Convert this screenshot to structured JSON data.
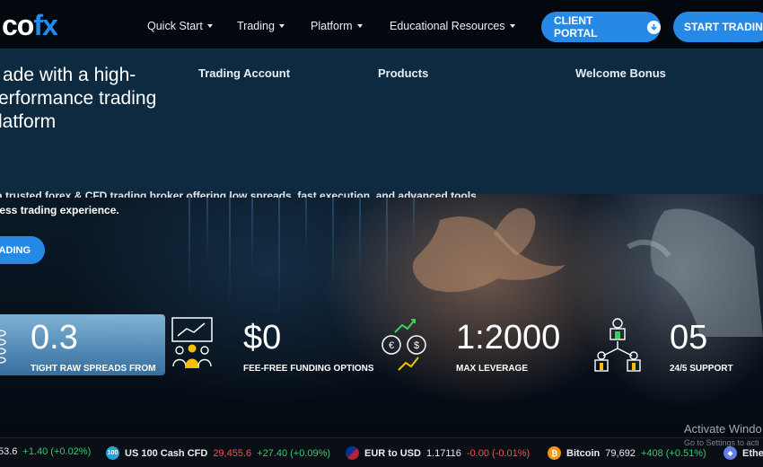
{
  "logo": {
    "part1": "co",
    "part2": "fx"
  },
  "nav": {
    "items": [
      {
        "label": "Quick Start"
      },
      {
        "label": "Trading"
      },
      {
        "label": "Platform"
      },
      {
        "label": "Educational Resources"
      }
    ],
    "client_portal": "CLIENT PORTAL",
    "start_trading": "START TRADING"
  },
  "dropdown": {
    "columns": [
      "Trading Account",
      "Products",
      "Welcome Bonus"
    ]
  },
  "hero": {
    "headline_1": "ade with a high-",
    "headline_2": "erformance trading",
    "headline_3": "latform",
    "sub_line_1": "a trusted forex & CFD trading broker offering low spreads, fast execution, and advanced tools",
    "sub_line_2": "less trading experience.",
    "button": "RADING"
  },
  "stats": [
    {
      "value": "0.3",
      "label": "TIGHT RAW SPREADS FROM",
      "icon": "stack-icon"
    },
    {
      "value": "$0",
      "label": "FEE-FREE FUNDING OPTIONS",
      "icon": "presentation-icon"
    },
    {
      "value": "1:2000",
      "label": "MAX LEVERAGE",
      "icon": "currency-exchange-icon"
    },
    {
      "value": "05",
      "label": "24/5 SUPPORT",
      "icon": "team-network-icon"
    }
  ],
  "ticker": [
    {
      "symbol": "",
      "price": "53.6",
      "change": "+1.40 (+0.02%)",
      "direction": "up",
      "icon_text": ""
    },
    {
      "symbol": "US 100 Cash CFD",
      "price": "29,455.6",
      "change": "+27.40 (+0.09%)",
      "direction": "up",
      "icon_text": "100",
      "icon_color": "#2a9fd6"
    },
    {
      "symbol": "EUR to USD",
      "price": "1.17116",
      "change": "-0.00 (-0.01%)",
      "direction": "down",
      "icon_text": "",
      "icon_color": "#3b5bdb"
    },
    {
      "symbol": "Bitcoin",
      "price": "79,692",
      "change": "+408 (+0.51%)",
      "direction": "up",
      "icon_text": "₿",
      "icon_color": "#f7931a"
    },
    {
      "symbol": "Ethe",
      "price": "",
      "change": "",
      "direction": "up",
      "icon_text": "◆",
      "icon_color": "#627eea"
    }
  ],
  "os_overlay": {
    "line1": "Activate Windo",
    "line2": "Go to Settings to acti"
  },
  "colors": {
    "accent": "#2789e6",
    "dropdown_bg": "#0d2a40",
    "up": "#2ecc71",
    "down": "#ff4d4d"
  }
}
